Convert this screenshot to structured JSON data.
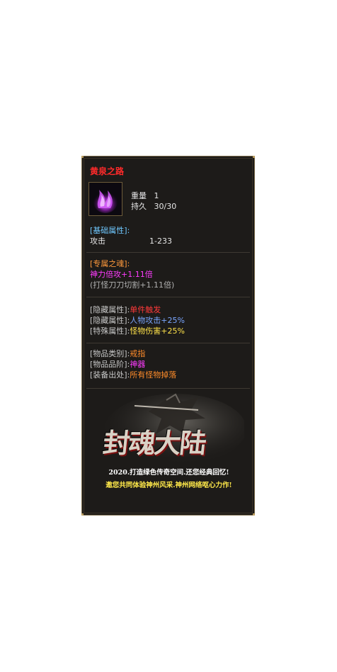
{
  "item": {
    "name": "黄泉之路",
    "weight_label": "重量",
    "weight_value": "1",
    "durability_label": "持久",
    "durability_value": "30/30"
  },
  "base_attrs": {
    "header": "[基础属性]:",
    "attack_label": "攻击",
    "attack_value": "1-233"
  },
  "exclusive": {
    "header": "[专属之魂]:",
    "line1": "神力倍攻+1.11倍",
    "line2": "(打怪刀刀切割+1.11倍)"
  },
  "hidden": {
    "row1_label": "[隐藏属性]:",
    "row1_value": "单件触发",
    "row2_label": "[隐藏属性]:",
    "row2_value": "人物攻击+25%",
    "row3_label": "[特殊属性]:",
    "row3_value": "怪物伤害+25%"
  },
  "info": {
    "category_label": "[物品类别]:",
    "category_value": "戒指",
    "grade_label": "[物品品阶]:",
    "grade_value": "神器",
    "source_label": "[装备出处]:",
    "source_value": "所有怪物掉落"
  },
  "banner": {
    "logo": "封魂大陆",
    "slogan1": "2020.打造绿色传奇空间.还您经典回忆!",
    "slogan2": "邀您共同体验神州风采.神州网络呕心力作!"
  },
  "colors": {
    "title": "#ff2a2a",
    "border": "#7a6a48",
    "background": "#1d1b19",
    "attr_blue": "#6fc8ff",
    "exclusive_orange": "#ff9a3c",
    "exclusive_magenta": "#ff3cff"
  },
  "icons": {
    "item_icon": "purple-flame-ring-icon"
  }
}
